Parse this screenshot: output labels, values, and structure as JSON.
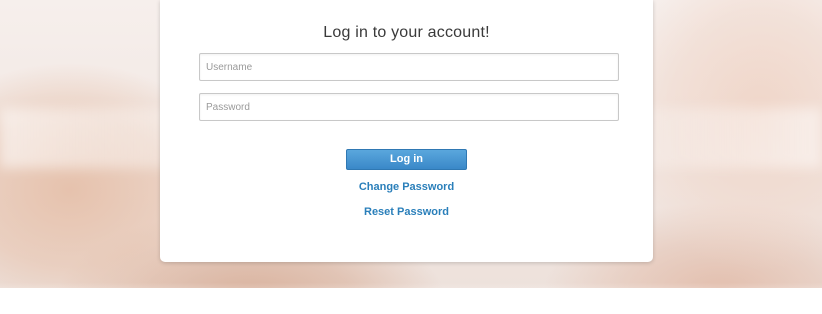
{
  "login": {
    "title": "Log in to your account!",
    "username_placeholder": "Username",
    "password_placeholder": "Password",
    "login_button": "Log in",
    "change_password_link": "Change Password",
    "reset_password_link": "Reset Password"
  },
  "colors": {
    "button": "#3a88c8",
    "link": "#2a7fba"
  }
}
